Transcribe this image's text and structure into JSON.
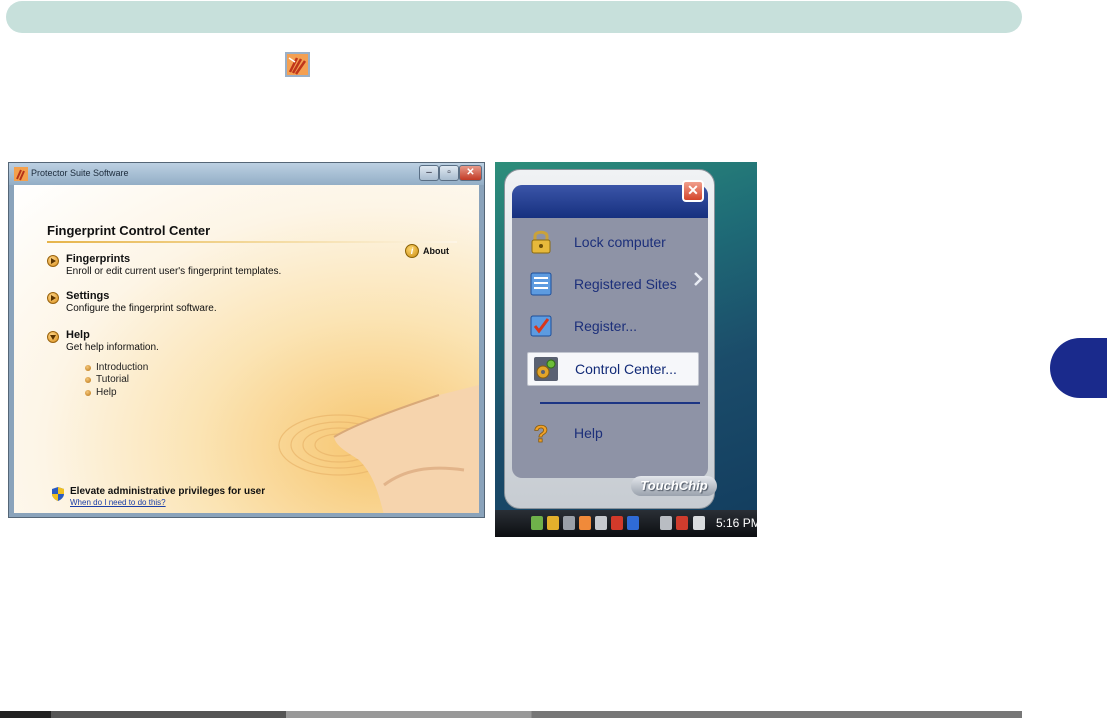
{
  "window": {
    "title": "Protector Suite Software",
    "heading": "Fingerprint Control Center",
    "about": "About",
    "sections": [
      {
        "title": "Fingerprints",
        "desc": "Enroll or edit current user's fingerprint templates."
      },
      {
        "title": "Settings",
        "desc": "Configure the fingerprint software."
      },
      {
        "title": "Help",
        "desc": "Get help information."
      }
    ],
    "help_links": [
      "Introduction",
      "Tutorial",
      "Help"
    ],
    "elevate": "Elevate administrative privileges for user",
    "elevate_link": "When do I need to do this?"
  },
  "popup": {
    "items": [
      {
        "label": "Lock computer",
        "icon": "padlock-icon"
      },
      {
        "label": "Registered Sites",
        "icon": "registered-sites-icon"
      },
      {
        "label": "Register...",
        "icon": "register-icon"
      },
      {
        "label": "Control Center...",
        "icon": "control-center-icon"
      },
      {
        "label": "Help",
        "icon": "question-mark-icon"
      }
    ],
    "brand": "TouchChip",
    "selected": "Control Center..."
  },
  "taskbar": {
    "clock": "5:16 PM"
  },
  "colors": {
    "accent_navy": "#1a2a8c",
    "header_bar": "#c7e0db",
    "link_blue": "#1a3ea8"
  }
}
